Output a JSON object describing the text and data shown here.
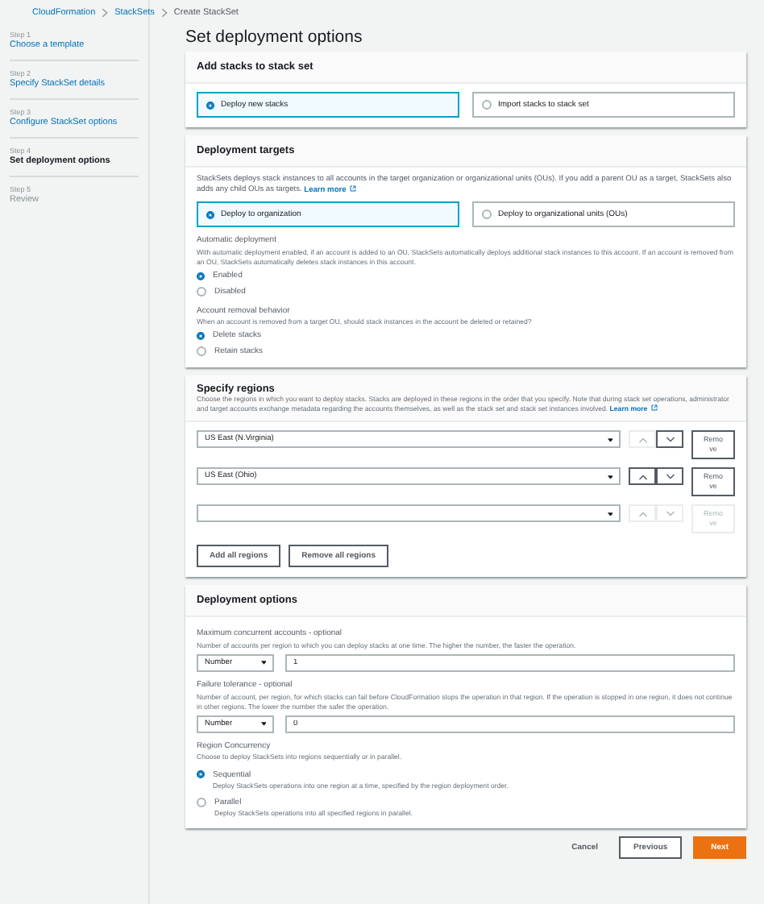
{
  "breadcrumbs": [
    {
      "label": "CloudFormation",
      "kind": "link"
    },
    {
      "label": "StackSets",
      "kind": "link"
    },
    {
      "label": "Create StackSet",
      "kind": "current"
    }
  ],
  "steps": [
    {
      "step": "Step 1",
      "label": "Choose a template",
      "selected": false,
      "disabled": false
    },
    {
      "step": "Step 2",
      "label": "Specify StackSet details",
      "selected": false,
      "disabled": false
    },
    {
      "step": "Step 3",
      "label": "Configure StackSet options",
      "selected": false,
      "disabled": false
    },
    {
      "step": "Step 4",
      "label": "Set deployment options",
      "selected": true,
      "disabled": false
    },
    {
      "step": "Step 5",
      "label": "Review",
      "selected": false,
      "disabled": true
    }
  ],
  "title": "Set deployment options",
  "add_stacks": {
    "title": "Add stacks to stack set",
    "options": [
      {
        "label": "Deploy new stacks",
        "selected": true
      },
      {
        "label": "Import stacks to stack set",
        "selected": false
      }
    ]
  },
  "deployment_targets": {
    "title": "Deployment targets",
    "description": "StackSets deploys stack instances to all accounts in the target organization or organizational units (OUs). If you add a parent OU as a target, StackSets also adds any child OUs as targets.",
    "link": "Learn more",
    "options": [
      {
        "label": "Deploy to organization",
        "selected": true
      },
      {
        "label": "Deploy to organizational units (OUs)",
        "selected": false
      }
    ],
    "groups": [
      {
        "label": "Automatic deployment",
        "description": "With automatic deployment enabled, if an account is added to an OU, StackSets automatically deploys additional stack instances to this account. If an account is removed from an OU, StackSets automatically deletes stack instances in this account.",
        "options": [
          {
            "label": "Enabled",
            "selected": true
          },
          {
            "label": "Disabled",
            "selected": false
          }
        ]
      },
      {
        "label": "Account removal behavior",
        "description": "When an account is removed from a target OU, should stack instances in the account be deleted or retained?",
        "options": [
          {
            "label": "Delete stacks",
            "selected": true
          },
          {
            "label": "Retain stacks",
            "selected": false
          }
        ]
      }
    ]
  },
  "regions": {
    "title": "Specify regions",
    "description": "Choose the regions in which you want to deploy stacks. Stacks are deployed in these regions in the order that you specify. Note that during stack set operations, administrator and target accounts exchange metadata regarding the accounts themselves, as well as the stack set and stack set instances involved.",
    "link": "Learn more",
    "rows": [
      {
        "value": "US East (N.Virginia)",
        "up_disabled": true,
        "down_disabled": false,
        "remove": "Remove",
        "remove_disabled": false
      },
      {
        "value": "US East (Ohio)",
        "up_disabled": false,
        "down_disabled": false,
        "remove": "Remove",
        "remove_disabled": false
      },
      {
        "up_disabled": true,
        "down_disabled": true,
        "remove": "Remove",
        "remove_disabled": true
      }
    ],
    "buttons": [
      "Add all regions",
      "Remove all regions"
    ]
  },
  "deployment_options": {
    "title": "Deployment options",
    "fields": [
      {
        "label": "Maximum concurrent accounts - optional",
        "description": "Number of accounts per region to which you can deploy stacks at one time. The higher the number, the faster the operation.",
        "type": "Number",
        "value": "1"
      },
      {
        "label": "Failure tolerance - optional",
        "description": "Number of account, per region, for which stacks can fail before CloudFormation stops the operation in that region. If the operation is stopped in one region, it does not continue in other regions. The lower the number the safer the operation.",
        "type": "Number",
        "value": "0"
      }
    ],
    "concurrency": {
      "label": "Region Concurrency",
      "description": "Choose to deploy StackSets into regions sequentially or in parallel.",
      "options": [
        {
          "label": "Sequential",
          "description": "Deploy StackSets operations into one region at a time, specified by the region deployment order.",
          "selected": true
        },
        {
          "label": "Parallel",
          "description": "Deploy StackSets operations into all specified regions in parallel.",
          "selected": false
        }
      ]
    }
  },
  "footer": {
    "cancel": "Cancel",
    "previous": "Previous",
    "next": "Next"
  }
}
